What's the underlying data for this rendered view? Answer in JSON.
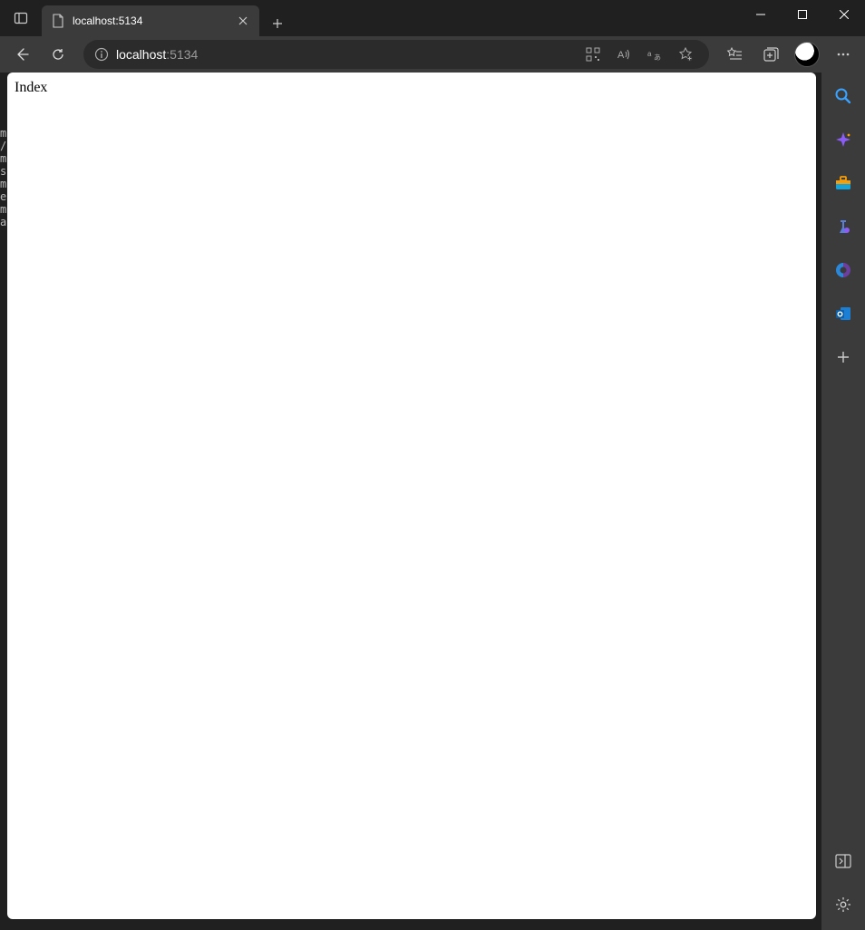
{
  "window": {
    "tab": {
      "title": "localhost:5134"
    }
  },
  "toolbar": {
    "address": {
      "host": "localhost",
      "port": ":5134"
    }
  },
  "page": {
    "body_text": "Index"
  },
  "background": {
    "fragments": "m\n/\nm\ns\nm\ne\nm\na"
  }
}
